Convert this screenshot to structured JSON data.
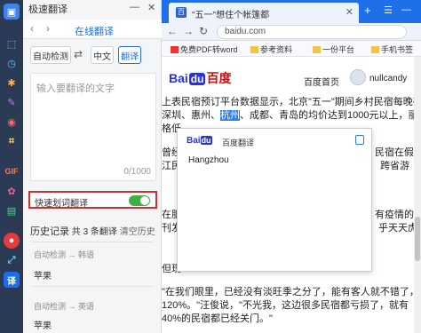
{
  "colors": {
    "rail": "#2b3b55",
    "accent": "#1c6fe8",
    "toggle_on": "#3cb043",
    "highlight_border": "#d92b2b",
    "tabbar": "#1e6fe8"
  },
  "translator": {
    "title": "极速翻译",
    "minimize_label": "—",
    "close_label": "✕",
    "nav_title": "在线翻译",
    "source_lang": "自动检测",
    "target_lang": "中文",
    "translate_button": "翻译",
    "input_placeholder": "输入要翻译的文字",
    "char_counter": "0/1000",
    "quick_translate_label": "快速划词翻译",
    "quick_translate_enabled": true,
    "history": {
      "title": "历史记录",
      "count_prefix": "共",
      "count": "3",
      "count_suffix": "条翻译",
      "clear_label": "清空历史",
      "items": [
        {
          "from": "自动检测",
          "to": "韩语",
          "word": "苹果"
        },
        {
          "from": "自动检测",
          "to": "英语",
          "word": "苹果"
        }
      ]
    }
  },
  "browser": {
    "tab_title": "\"五一\"想住个帐篷都",
    "address": "baidu.com",
    "bookmarks": [
      {
        "label": "免费PDF转word"
      },
      {
        "label": "参考资料"
      },
      {
        "label": "一份平台"
      },
      {
        "label": "手机书签"
      }
    ],
    "baidu": {
      "logo_bai": "Bai",
      "logo_du": "du",
      "logo_cn": "百度",
      "home_link": "百度首页",
      "username": "nullcandy"
    },
    "article_lines": [
      "上表民宿预订平台数据显示，北京\"五一\"期间乡村民宿每晚夜",
      "深圳、惠州、",
      "格低",
      "曾经",
      "江民",
      "在服",
      "刊发",
      "但现",
      "\"在我们眼里，已经没有淡旺季之分了，能有客人就不错了，现",
      "120%。\"汪俊说，\"不光我，这边很多民宿都亏损了，就有",
      "40%的民宿都已经关门。\""
    ],
    "article_line1_tail": "、成都、青岛的均价达到1000元以上，丽江乡",
    "article_highlight": "杭州",
    "article_right_1": "民宿在假",
    "article_right_2": "跨省游",
    "article_right_3": "有疫情的时",
    "article_right_4": "乎天天虎",
    "popup": {
      "title": "百度翻译",
      "result": "Hangzhou"
    }
  }
}
